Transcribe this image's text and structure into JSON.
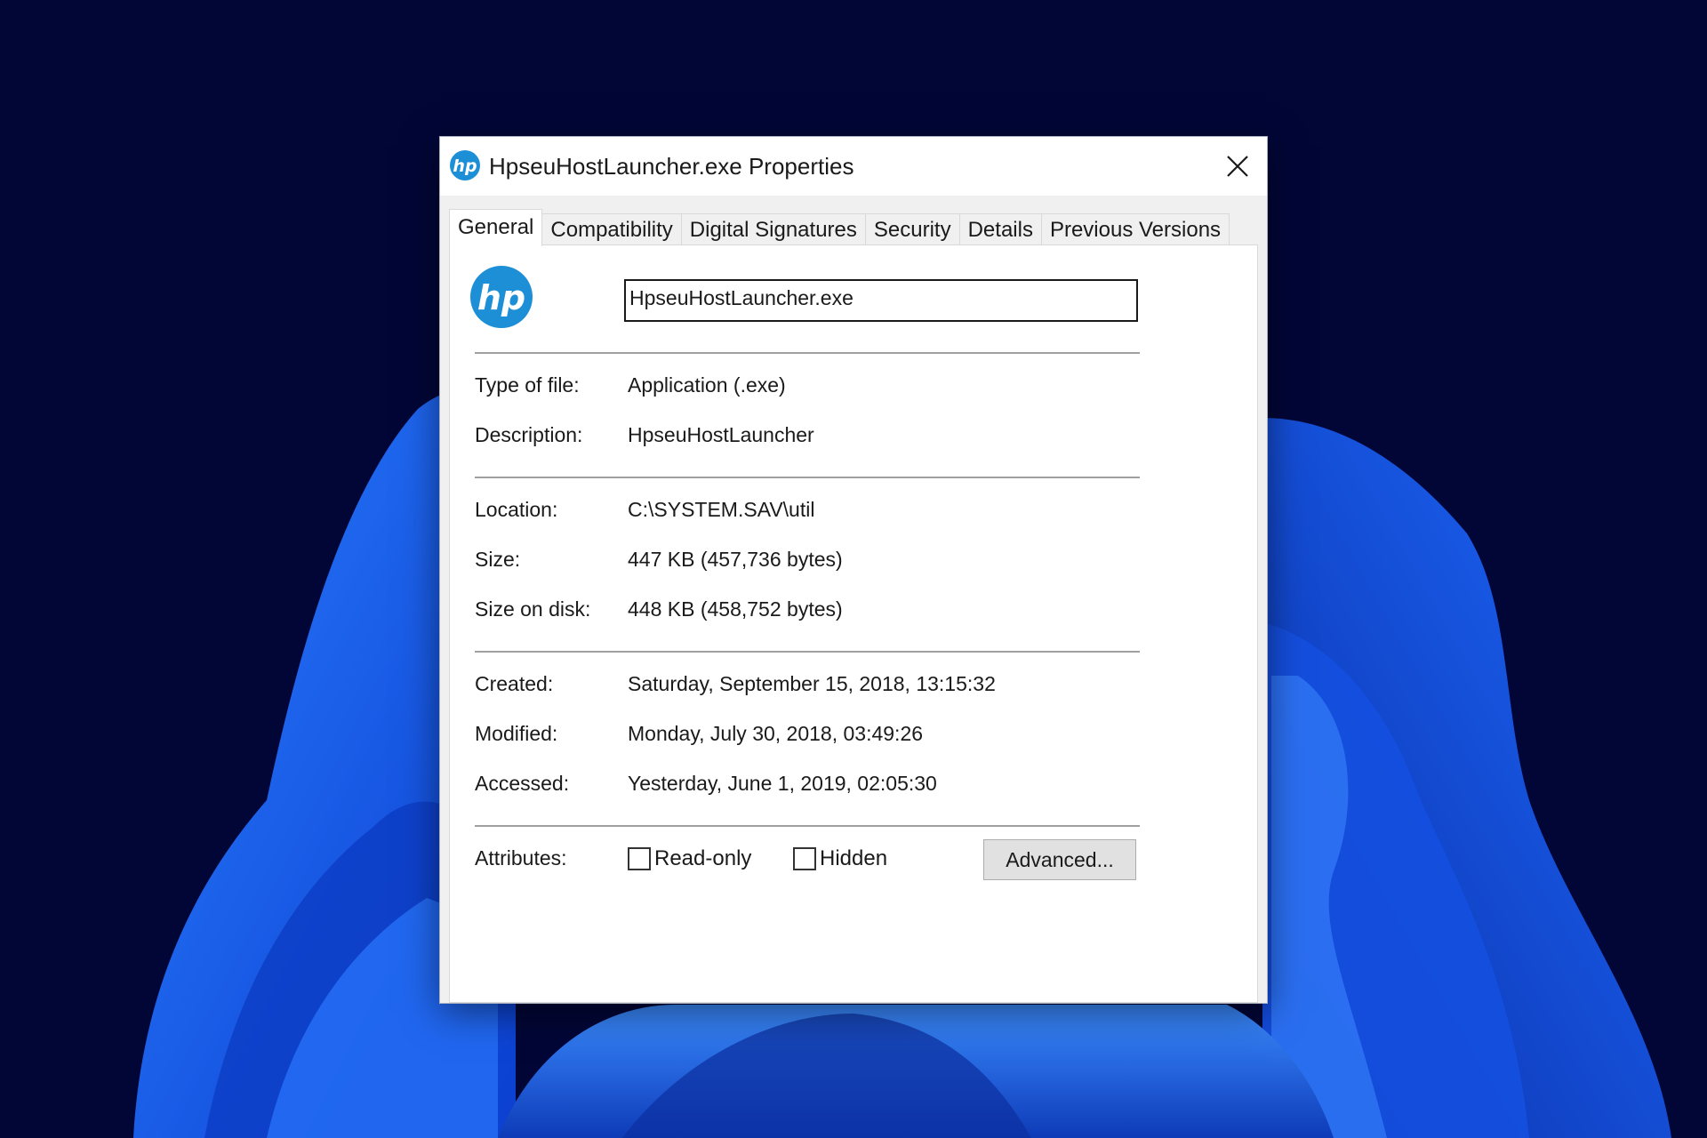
{
  "window": {
    "title": "HpseuHostLauncher.exe Properties"
  },
  "tabs": [
    {
      "label": "General",
      "active": true
    },
    {
      "label": "Compatibility",
      "active": false
    },
    {
      "label": "Digital Signatures",
      "active": false
    },
    {
      "label": "Security",
      "active": false
    },
    {
      "label": "Details",
      "active": false
    },
    {
      "label": "Previous Versions",
      "active": false
    }
  ],
  "general": {
    "file_name": "HpseuHostLauncher.exe",
    "type_of_file": {
      "label": "Type of file:",
      "value": "Application (.exe)"
    },
    "description": {
      "label": "Description:",
      "value": "HpseuHostLauncher"
    },
    "location": {
      "label": "Location:",
      "value": "C:\\SYSTEM.SAV\\util"
    },
    "size": {
      "label": "Size:",
      "value": "447 KB (457,736 bytes)"
    },
    "size_on_disk": {
      "label": "Size on disk:",
      "value": "448 KB (458,752 bytes)"
    },
    "created": {
      "label": "Created:",
      "value": "Saturday, September 15, 2018, 13:15:32"
    },
    "modified": {
      "label": "Modified:",
      "value": "Monday, July 30, 2018, 03:49:26"
    },
    "accessed": {
      "label": "Accessed:",
      "value": "Yesterday, June 1, 2019, 02:05:30"
    },
    "attributes": {
      "label": "Attributes:",
      "read_only": {
        "label": "Read-only",
        "checked": false
      },
      "hidden": {
        "label": "Hidden",
        "checked": false
      },
      "advanced_label": "Advanced..."
    }
  },
  "icons": {
    "app": "hp-logo-icon",
    "close": "close-icon"
  },
  "colors": {
    "hp_blue": "#1c8fd6",
    "desktop_bg": "#020637",
    "wallpaper_blue": "#1a5cf0"
  }
}
